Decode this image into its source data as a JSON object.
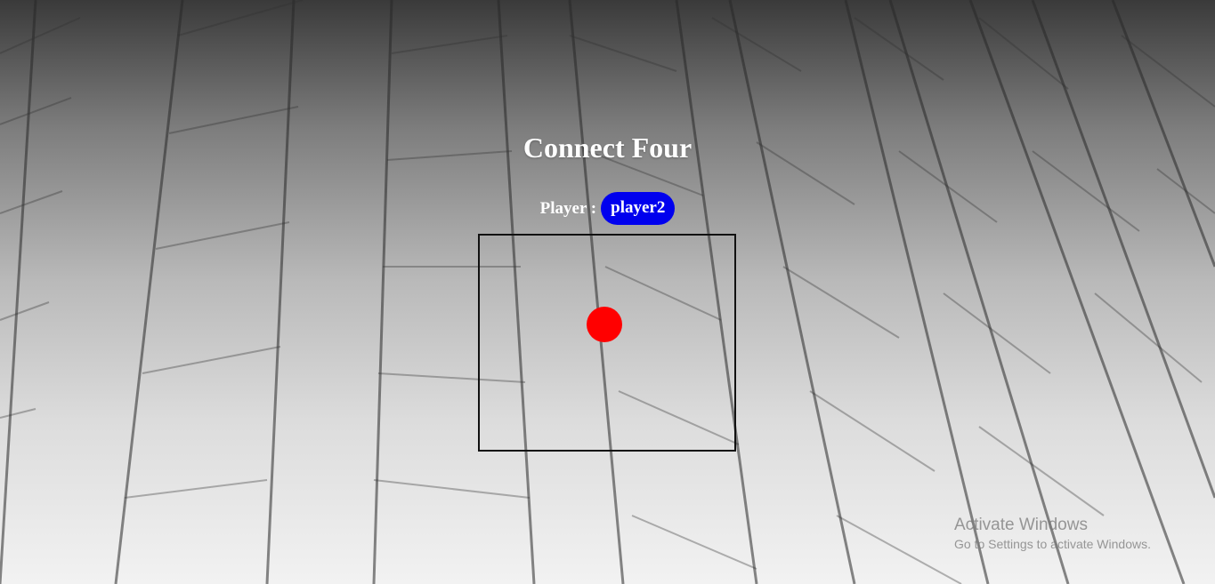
{
  "app": {
    "title": "Connect Four"
  },
  "status": {
    "player_label": "Player :",
    "current_player": "player2",
    "badge_color": "#0000ee"
  },
  "board": {
    "disc_color": "#ff0000"
  },
  "watermark": {
    "title": "Activate Windows",
    "subtitle": "Go to Settings to activate Windows."
  }
}
